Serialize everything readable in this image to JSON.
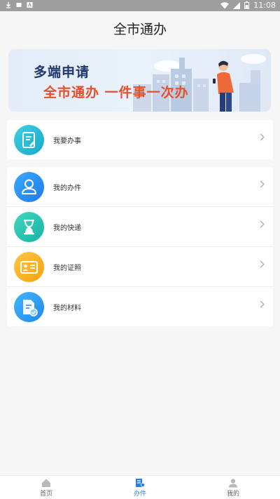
{
  "statusbar": {
    "time": "11:08"
  },
  "appbar": {
    "title": "全市通办"
  },
  "banner": {
    "line1": "多端申请",
    "line2": "全市通办  一件事一次办"
  },
  "cards": {
    "main": {
      "label": "我要办事"
    },
    "list": [
      {
        "label": "我的办件",
        "color_from": "#3aa9ff",
        "color_to": "#1e7be8",
        "icon": "user-icon"
      },
      {
        "label": "我的快递",
        "color_from": "#42d6c0",
        "color_to": "#15b3a5",
        "icon": "hourglass-icon"
      },
      {
        "label": "我的证照",
        "color_from": "#ffc544",
        "color_to": "#f5a312",
        "icon": "id-card-icon"
      },
      {
        "label": "我的材料",
        "color_from": "#44b6ff",
        "color_to": "#2188ea",
        "icon": "document-check-icon"
      }
    ]
  },
  "tabbar": {
    "tabs": [
      {
        "label": "首页",
        "icon": "home-icon"
      },
      {
        "label": "办件",
        "icon": "handle-icon"
      },
      {
        "label": "我的",
        "icon": "profile-icon"
      }
    ],
    "active_color": "#2b7de9"
  }
}
